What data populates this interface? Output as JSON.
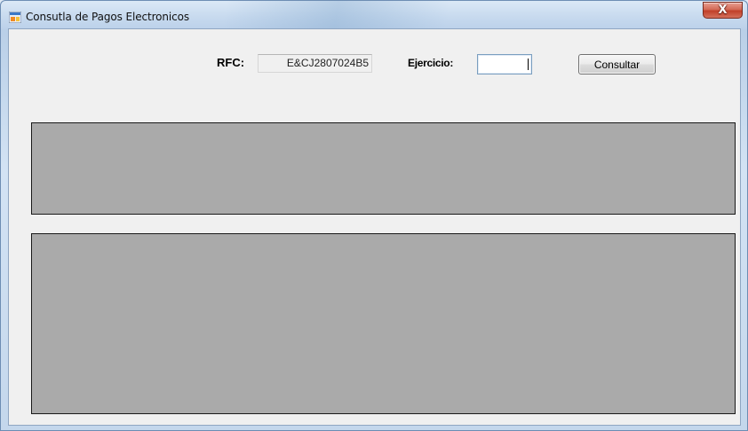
{
  "window": {
    "title": "Consutla de Pagos Electronicos",
    "close_label": "X"
  },
  "form": {
    "rfc_label": "RFC:",
    "rfc_value": "E&CJ2807024B5",
    "ejercicio_label": "Ejercicio:",
    "ejercicio_value": "",
    "consultar_label": "Consultar"
  },
  "icons": {
    "app": "app-window-icon",
    "close": "close-icon"
  },
  "colors": {
    "panel_background": "#aaaaaa",
    "client_background": "#f0f0f0",
    "close_button": "#c1402a"
  }
}
